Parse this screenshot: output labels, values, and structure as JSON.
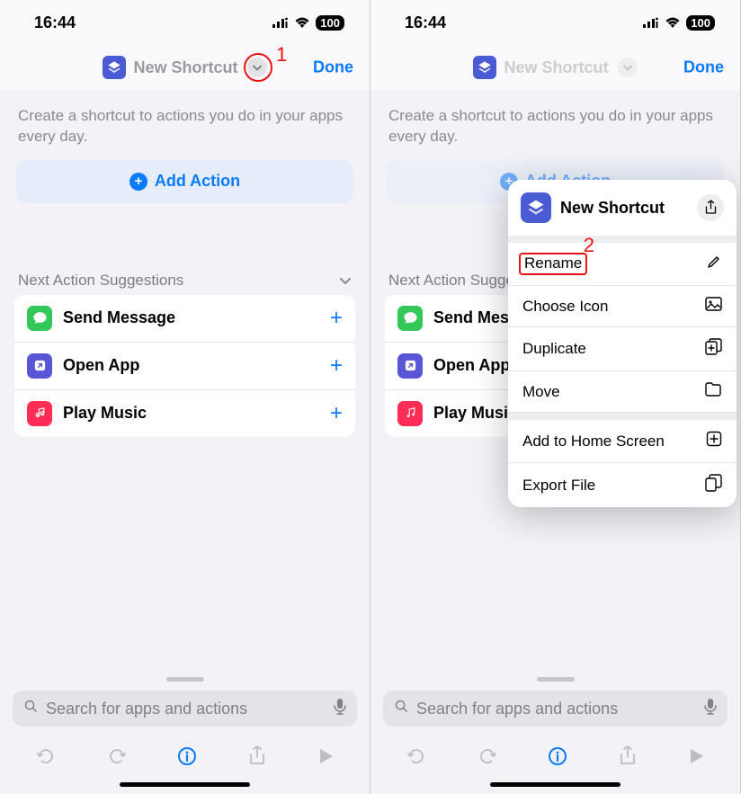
{
  "statusbar": {
    "time": "16:44",
    "battery": "100"
  },
  "navbar": {
    "title": "New Shortcut",
    "done": "Done"
  },
  "callouts": {
    "c1": "1",
    "c2": "2"
  },
  "helper_text": "Create a shortcut to actions you do in your apps every day.",
  "add_action": "Add Action",
  "suggestions_header": "Next Action Suggestions",
  "suggestions": {
    "item0": {
      "label": "Send Message",
      "icon_bg": "#34c759"
    },
    "item1": {
      "label": "Open App",
      "icon_bg": "#5856d6"
    },
    "item2": {
      "label": "Play Music",
      "icon_bg": "#ff2d55"
    }
  },
  "search": {
    "placeholder": "Search for apps and actions"
  },
  "popover": {
    "title": "New Shortcut",
    "items": {
      "rename": "Rename",
      "choose_icon": "Choose Icon",
      "duplicate": "Duplicate",
      "move": "Move",
      "home_screen": "Add to Home Screen",
      "export": "Export File"
    }
  }
}
